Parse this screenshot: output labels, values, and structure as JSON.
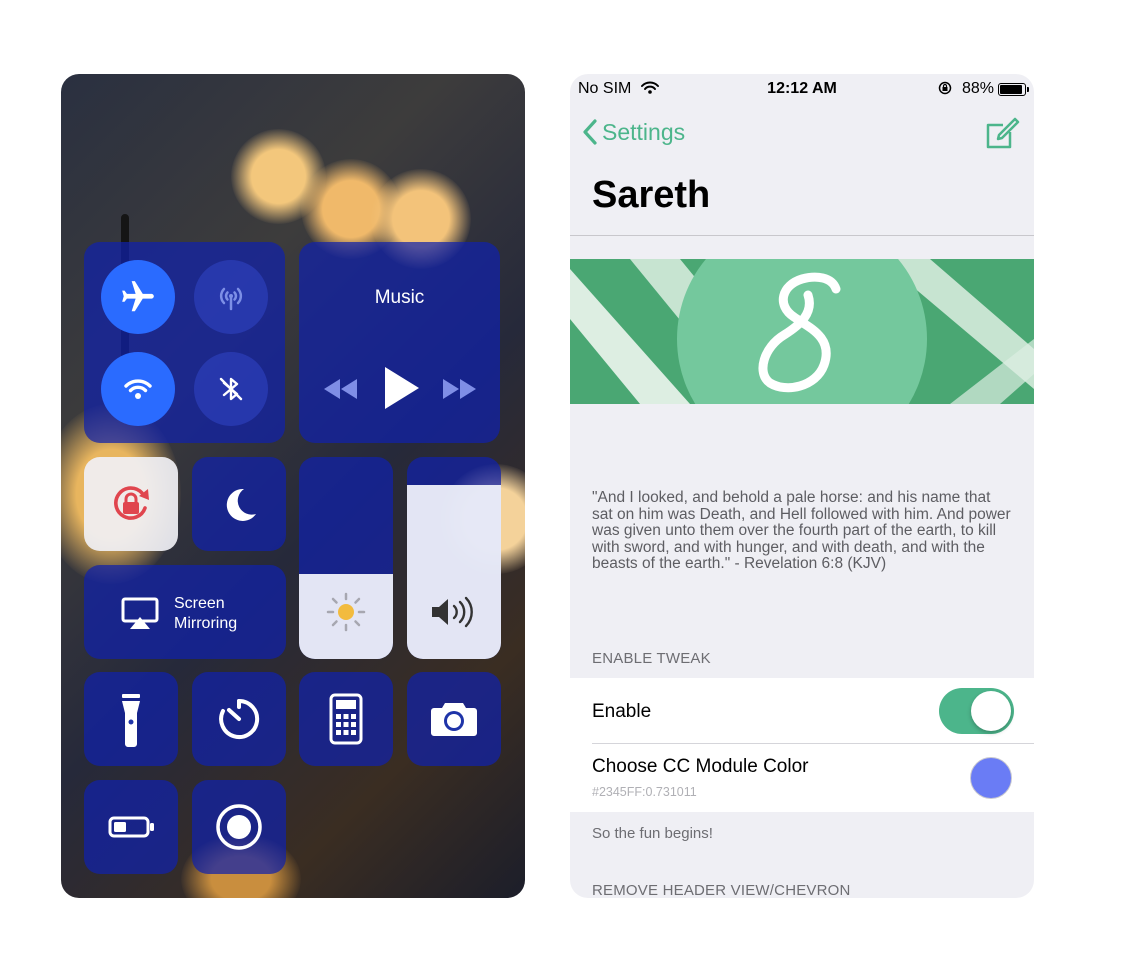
{
  "control_center": {
    "music_label": "Music",
    "screen_mirroring_line1": "Screen",
    "screen_mirroring_line2": "Mirroring",
    "connectivity": {
      "airplane_on": true,
      "cellular_on": false,
      "wifi_on": true,
      "bluetooth_on": false
    },
    "brightness_level": 0.42,
    "volume_level": 0.86,
    "colors": {
      "module": "#2345FF",
      "module_alpha": 0.731011,
      "active_button": "#2a6bff",
      "lock_red": "#e0454e"
    },
    "icons": [
      "airplane-icon",
      "cellular-data-icon",
      "wifi-icon",
      "bluetooth-icon",
      "rewind-icon",
      "play-icon",
      "fast-forward-icon",
      "rotation-lock-icon",
      "moon-icon",
      "airplay-icon",
      "brightness-icon",
      "volume-icon",
      "flashlight-icon",
      "timer-icon",
      "calculator-icon",
      "camera-icon",
      "low-power-icon",
      "screen-record-icon"
    ]
  },
  "settings": {
    "status_bar": {
      "carrier": "No SIM",
      "time": "12:12 AM",
      "battery": "88%"
    },
    "back_label": "Settings",
    "title": "Sareth",
    "quote": "\"And I looked, and behold a pale horse: and his name that sat on him was Death, and Hell followed with him. And power was given unto them over the fourth part of the earth, to kill with sword, and with hunger, and with death, and with the beasts of the earth.\" - Revelation 6:8 (KJV)",
    "section_enable": "ENABLE TWEAK",
    "enable_label": "Enable",
    "enable_on": true,
    "color_label": "Choose CC Module Color",
    "color_value": "#2345FF:0.731011",
    "color_swatch": "#6a7cf5",
    "footer_text": "So the fun begins!",
    "section_remove": "REMOVE HEADER VIEW/CHEVRON",
    "accent": "#4cb58b"
  }
}
